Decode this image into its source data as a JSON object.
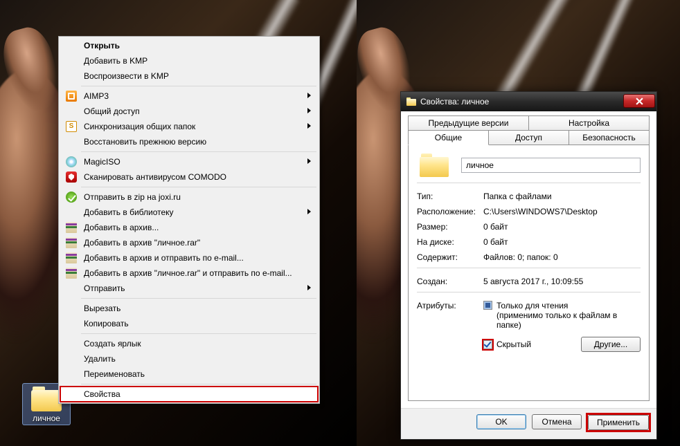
{
  "desktop": {
    "folder_label": "личное"
  },
  "context_menu": {
    "open": "Открыть",
    "add_kmp": "Добавить в KMP",
    "play_kmp": "Воспроизвести в KMP",
    "aimp": "AIMP3",
    "share": "Общий доступ",
    "sync": "Синхронизация общих папок",
    "restore": "Восстановить прежнюю версию",
    "magiciso": "MagicISO",
    "comodo": "Сканировать антивирусом COMODO",
    "joxi": "Отправить в zip на joxi.ru",
    "library": "Добавить в библиотеку",
    "add_archive": "Добавить в архив...",
    "add_archive_name": "Добавить в архив \"личное.rar\"",
    "archive_email": "Добавить в архив и отправить по e-mail...",
    "archive_name_email": "Добавить в архив \"личное.rar\" и отправить по e-mail...",
    "send_to": "Отправить",
    "cut": "Вырезать",
    "copy": "Копировать",
    "shortcut": "Создать ярлык",
    "delete": "Удалить",
    "rename": "Переименовать",
    "properties": "Свойства"
  },
  "dialog": {
    "title": "Свойства: личное",
    "tabs": {
      "prev": "Предыдущие версии",
      "config": "Настройка",
      "general": "Общие",
      "access": "Доступ",
      "security": "Безопасность"
    },
    "name_value": "личное",
    "rows": {
      "type_label": "Тип:",
      "type_value": "Папка с файлами",
      "loc_label": "Расположение:",
      "loc_value": "C:\\Users\\WINDOWS7\\Desktop",
      "size_label": "Размер:",
      "size_value": "0 байт",
      "ondisk_label": "На диске:",
      "ondisk_value": "0 байт",
      "contains_label": "Содержит:",
      "contains_value": "Файлов: 0; папок: 0",
      "created_label": "Создан:",
      "created_value": "5 августа 2017 г., 10:09:55",
      "attr_label": "Атрибуты:",
      "readonly": "Только для чтения",
      "readonly_hint": "(применимо только к файлам в папке)",
      "hidden": "Скрытый",
      "other_btn": "Другие..."
    },
    "buttons": {
      "ok": "OK",
      "cancel": "Отмена",
      "apply": "Применить"
    }
  }
}
